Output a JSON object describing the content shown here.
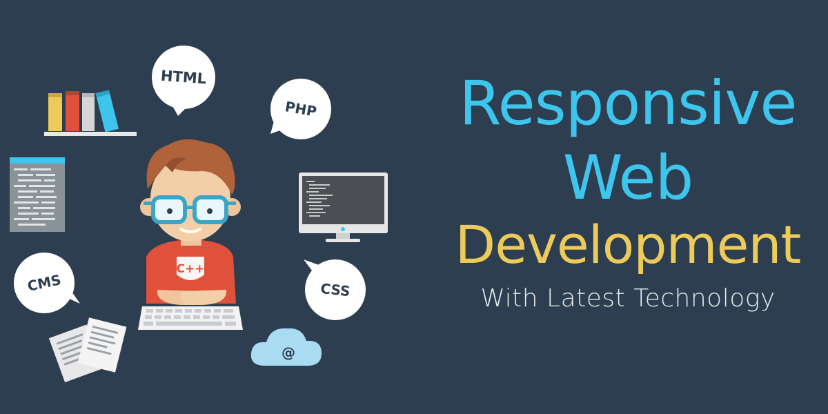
{
  "headline": {
    "line1": "Responsive",
    "line2": "Web",
    "line3": "Development",
    "tagline": "With Latest Technology"
  },
  "bubbles": {
    "html": "HTML",
    "php": "PHP",
    "cms": "CMS",
    "css": "CSS"
  },
  "shirt_label": "C++",
  "cloud_symbol": "@",
  "colors": {
    "background": "#2c3e50",
    "accent_blue": "#3ec5ee",
    "accent_yellow": "#edcb5a",
    "shirt_red": "#e0513c"
  },
  "icons": [
    "books-icon",
    "code-document-icon",
    "monitor-icon",
    "keyboard-icon",
    "documents-icon",
    "cloud-icon",
    "developer-avatar"
  ]
}
